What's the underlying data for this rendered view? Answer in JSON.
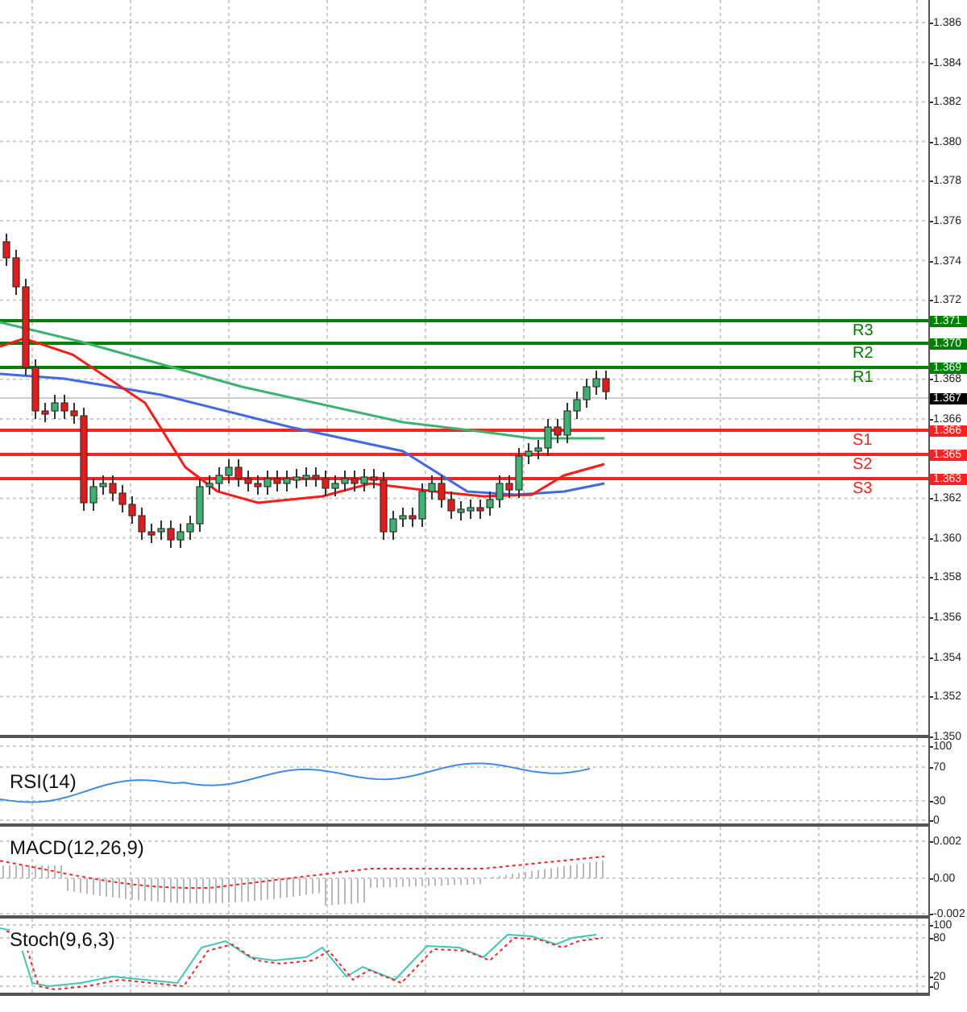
{
  "price_axis": {
    "ticks": [
      "1.386",
      "1.384",
      "1.382",
      "1.380",
      "1.378",
      "1.376",
      "1.374",
      "1.372",
      "1.368",
      "1.366",
      "1.362",
      "1.360",
      "1.358",
      "1.356",
      "1.354",
      "1.352",
      "1.350"
    ]
  },
  "levels": [
    {
      "label": "R3",
      "price": "1.371",
      "color": "#008000"
    },
    {
      "label": "R2",
      "price": "1.370",
      "color": "#008000"
    },
    {
      "label": "R1",
      "price": "1.369",
      "color": "#008000"
    },
    {
      "label": "S1",
      "price": "1.366",
      "color": "#ff2020"
    },
    {
      "label": "S2",
      "price": "1.365",
      "color": "#ff2020"
    },
    {
      "label": "S3",
      "price": "1.363",
      "color": "#ff2020"
    }
  ],
  "current_price": "1.367",
  "indicators": [
    {
      "kind": "rsi",
      "label": "RSI(14)",
      "ticks": [
        "100",
        "70",
        "30",
        "0"
      ]
    },
    {
      "kind": "macd",
      "label": "MACD(12,26,9)",
      "ticks": [
        "0.002",
        "0.00",
        "-0.002"
      ]
    },
    {
      "kind": "stoch",
      "label": "Stoch(9,6,3)",
      "ticks": [
        "100",
        "80",
        "20",
        "0"
      ]
    }
  ]
}
